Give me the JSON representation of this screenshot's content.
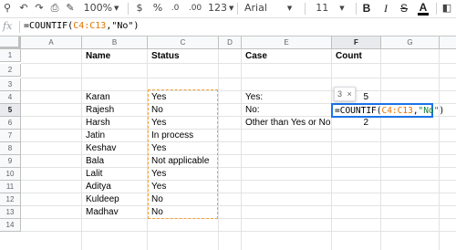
{
  "toolbar": {
    "zoom": "100%",
    "currency": "$",
    "percent": "%",
    "decrease_decimals": ".0",
    "increase_decimals": ".00",
    "more_formats": "123",
    "font": "Arial",
    "font_size": "11",
    "bold": "B",
    "italic": "I",
    "strikethrough": "S",
    "font_color_letter": "A"
  },
  "formula_bar": {
    "fx": "fx",
    "prefix": "=COUNTIF(",
    "ref": "C4:C13",
    "suffix": ",\"No\")"
  },
  "columns": [
    "A",
    "B",
    "C",
    "D",
    "E",
    "F",
    "G"
  ],
  "rows": [
    "1",
    "2",
    "3",
    "4",
    "5",
    "6",
    "7",
    "8",
    "9",
    "10",
    "11",
    "12",
    "13",
    "14"
  ],
  "sheet": {
    "name_header": "Name",
    "status_header": "Status",
    "case_header": "Case",
    "count_header": "Count",
    "names": [
      "Karan",
      "Rajesh",
      "Harsh",
      "Jatin",
      "Keshav",
      "Bala",
      "Lalit",
      "Aditya",
      "Kuldeep",
      "Madhav"
    ],
    "statuses": [
      "Yes",
      "No",
      "Yes",
      "In process",
      "Yes",
      "Not applicable",
      "Yes",
      "Yes",
      "No",
      "No"
    ],
    "cases": [
      "Yes:",
      "No:",
      "Other than Yes or No"
    ],
    "counts": [
      "5",
      "",
      "2"
    ]
  },
  "edit_cell": {
    "prefix": "=COUNTIF(",
    "ref": "C4:C13",
    "comma": ",",
    "string": "\"No\"",
    "close": ")"
  },
  "tooltip": {
    "value": "3",
    "close": "×"
  },
  "colors": {
    "active_border": "#1a73e8",
    "marquee": "#f2a33a",
    "ref": "#e37400",
    "string": "#188038"
  }
}
